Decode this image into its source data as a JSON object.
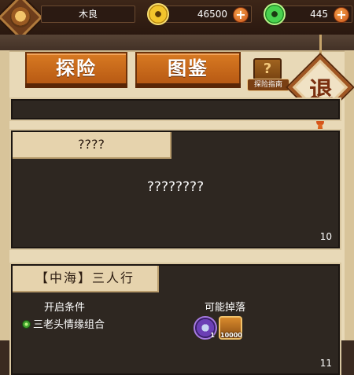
{
  "player": {
    "name": "木良"
  },
  "currencies": {
    "gold": "46500",
    "jade": "445"
  },
  "tabs": [
    {
      "label": "探险"
    },
    {
      "label": "图鉴"
    }
  ],
  "guide": {
    "label": "探险指南",
    "icon_glyph": "?"
  },
  "exit": {
    "label": "退"
  },
  "stages": [
    {
      "title": "????",
      "description": "????????",
      "number": "10"
    },
    {
      "title": "【中海】三人行",
      "number": "11",
      "condition_heading": "开启条件",
      "condition": "三老头情缘组合",
      "drops_heading": "可能掉落",
      "drops": [
        {
          "icon": "hourglass-icon",
          "count": "1"
        },
        {
          "icon": "coin-bag-icon",
          "count": "10000"
        }
      ]
    }
  ],
  "colors": {
    "tab_orange": "#d87a22",
    "panel_dark": "#2e2721",
    "parchment": "#e8d9b7",
    "gold_coin": "#f3c52c",
    "jade_coin": "#49d24f"
  }
}
